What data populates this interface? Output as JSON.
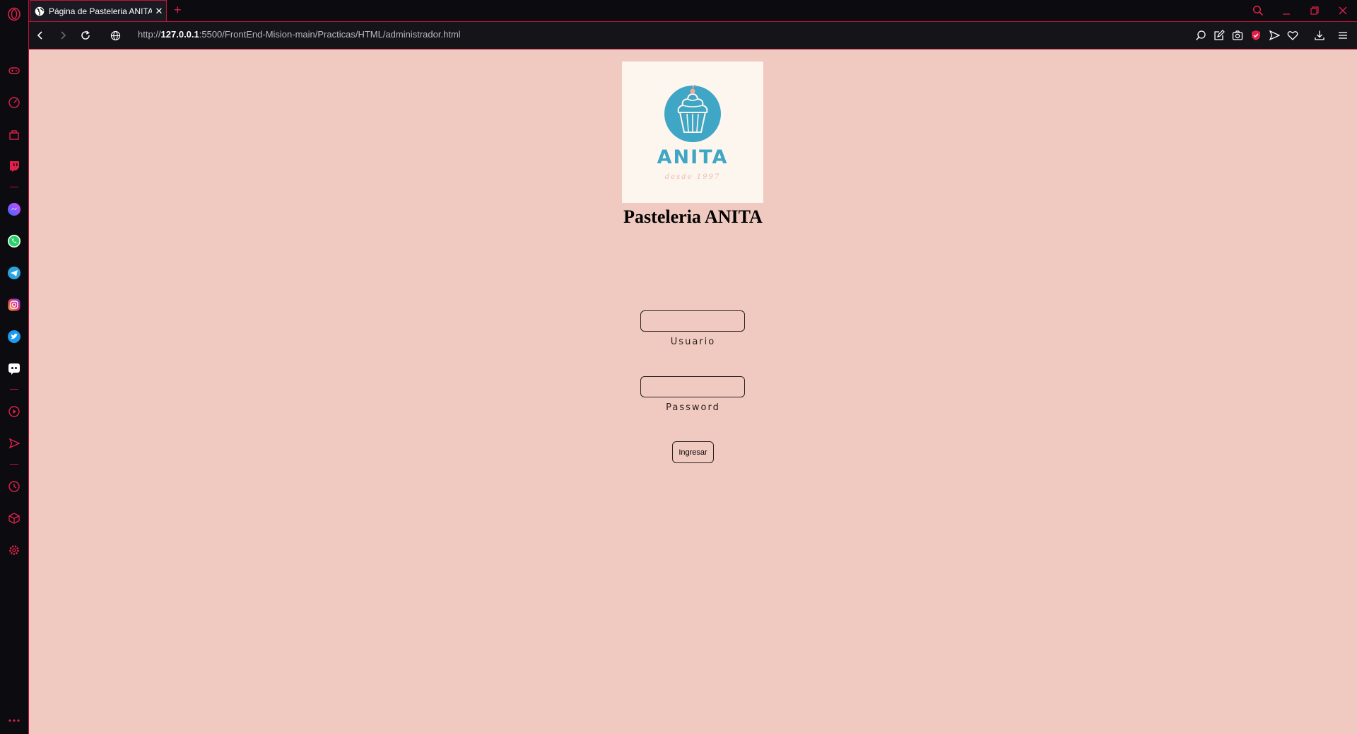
{
  "browser": {
    "tab_title": "Página de Pasteleria ANITA",
    "tab_close": "✕",
    "new_tab": "+",
    "url_scheme": "http://",
    "url_host": "127.0.0.1",
    "url_rest": ":5500/FrontEnd-Mision-main/Practicas/HTML/administrador.html",
    "accent_color": "#e0224a"
  },
  "sidebar": {
    "icons": [
      "opera-logo-icon",
      "game-controller-icon",
      "speed-dial-icon",
      "bag-icon",
      "twitch-icon",
      "messenger-icon",
      "whatsapp-icon",
      "telegram-icon",
      "instagram-icon",
      "twitter-icon",
      "discord-icon",
      "player-icon",
      "send-icon",
      "history-icon",
      "cube-icon",
      "settings-icon",
      "more-icon"
    ]
  },
  "page": {
    "background_color": "#f0cac0",
    "logo": {
      "word": "ANITA",
      "since": "desde 1997",
      "circle_color": "#3fa6c6"
    },
    "title": "Pasteleria ANITA",
    "form": {
      "user_label": "Usuario",
      "user_value": "",
      "password_label": "Password",
      "password_value": "",
      "submit_label": "Ingresar"
    }
  }
}
